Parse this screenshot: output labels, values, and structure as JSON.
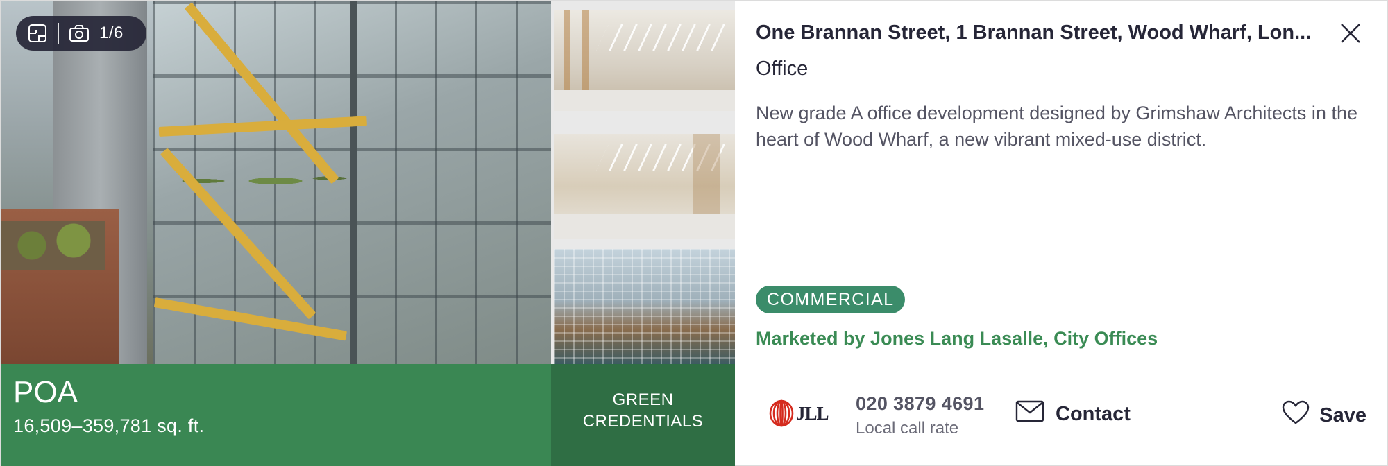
{
  "gallery": {
    "photo_counter": "1/6",
    "icons": [
      "floorplan-icon",
      "camera-icon"
    ]
  },
  "price_bar": {
    "price": "POA",
    "size": "16,509–359,781 sq. ft.",
    "green_credentials": "GREEN CREDENTIALS"
  },
  "listing": {
    "title": "One Brannan Street, 1 Brannan Street, Wood Wharf, Lon...",
    "type": "Office",
    "description": "New grade A office development designed by Grimshaw Architects in the heart of Wood Wharf, a new vibrant mixed-use district.",
    "badge": "COMMERCIAL",
    "marketed_by": "Marketed by Jones Lang Lasalle, City Offices"
  },
  "agent": {
    "logo_text": "JLL",
    "phone": "020 3879 4691",
    "call_rate": "Local call rate",
    "contact_label": "Contact",
    "save_label": "Save"
  },
  "colors": {
    "price_bar": "#3a8753",
    "green_credentials": "#2f6e44",
    "badge": "#3b8c6a",
    "marketed_by": "#3a8b54",
    "text": "#262637"
  }
}
